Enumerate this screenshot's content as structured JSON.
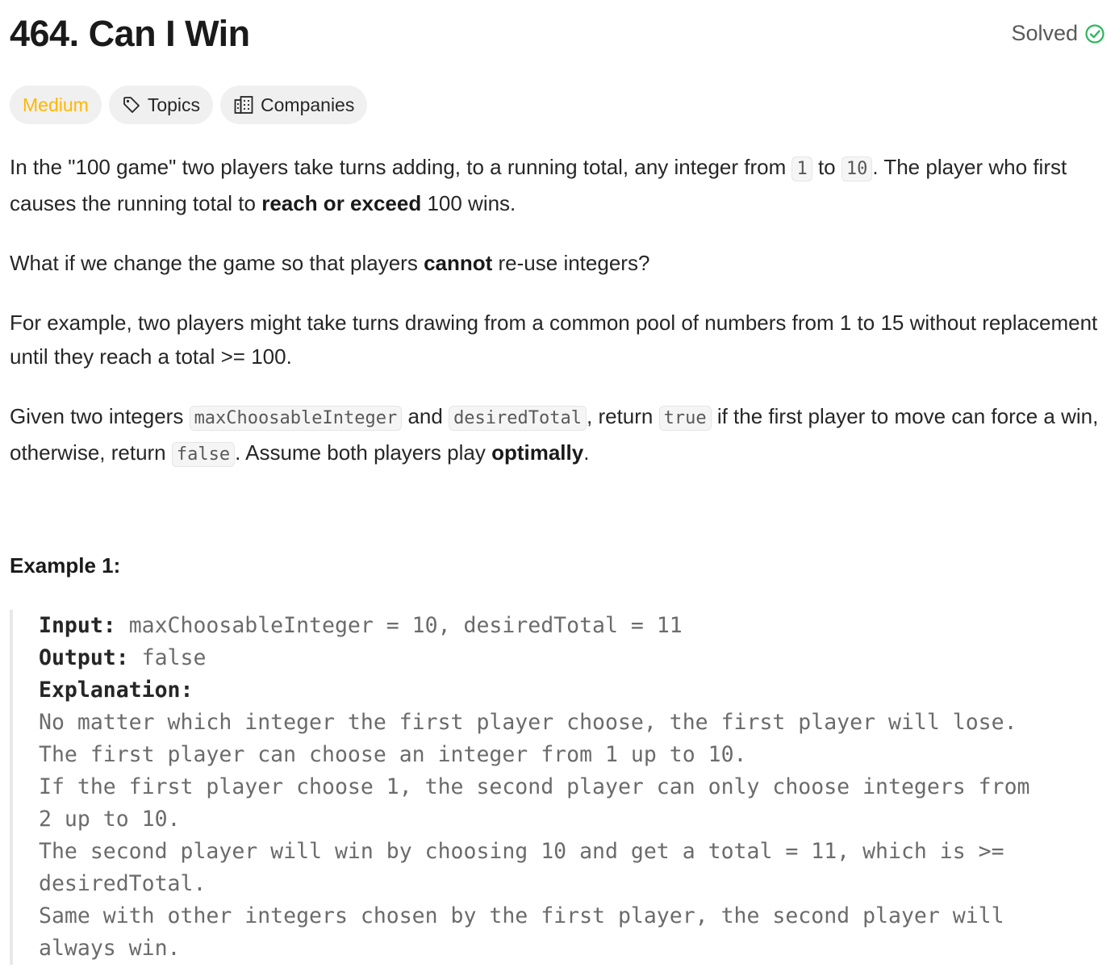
{
  "problem": {
    "title": "464. Can I Win",
    "status": "Solved"
  },
  "tags": {
    "difficulty": "Medium",
    "topics": "Topics",
    "companies": "Companies"
  },
  "description": {
    "p1": {
      "a": "In the \"100 game\" two players take turns adding, to a running total, any integer from ",
      "code1": "1",
      "b": " to ",
      "code2": "10",
      "c": ". The player who first causes the running total to ",
      "bold": "reach or exceed",
      "d": " 100 wins."
    },
    "p2": {
      "a": "What if we change the game so that players ",
      "bold": "cannot",
      "b": " re-use integers?"
    },
    "p3": {
      "text": "For example, two players might take turns drawing from a common pool of numbers from 1 to 15 without replacement until they reach a total >= 100."
    },
    "p4": {
      "a": "Given two integers ",
      "code1": "maxChoosableInteger",
      "b": " and ",
      "code2": "desiredTotal",
      "c": ", return ",
      "code3": "true",
      "d": " if the first player to move can force a win, otherwise, return ",
      "code4": "false",
      "e": ". Assume both players play ",
      "bold": "optimally",
      "f": "."
    }
  },
  "example1": {
    "title": "Example 1:",
    "input_label": "Input:",
    "input_value": " maxChoosableInteger = 10, desiredTotal = 11",
    "output_label": "Output:",
    "output_value": " false",
    "explanation_label": "Explanation:",
    "explanation_lines": [
      "No matter which integer the first player choose, the first player will lose.",
      "The first player can choose an integer from 1 up to 10.",
      "If the first player choose 1, the second player can only choose integers from",
      "2 up to 10.",
      "The second player will win by choosing 10 and get a total = 11, which is >=",
      "desiredTotal.",
      "Same with other integers chosen by the first player, the second player will",
      "always win."
    ]
  },
  "colors": {
    "difficulty_medium": "#ffb800",
    "solved_check": "#2db55d"
  },
  "icons": {
    "solved": "check-circle-icon",
    "topics": "tag-icon",
    "companies": "building-icon"
  }
}
